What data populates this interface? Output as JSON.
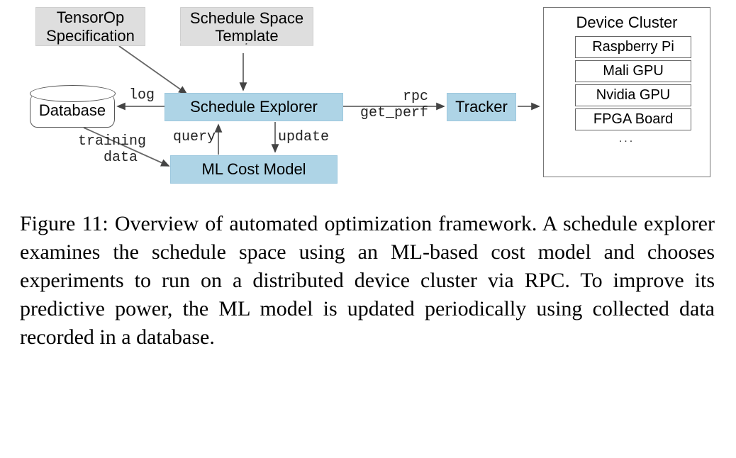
{
  "nodes": {
    "tensorop": "TensorOp\nSpecification",
    "schedSpace": "Schedule Space\nTemplate",
    "database": "Database",
    "schedExpl": "Schedule Explorer",
    "mlCost": "ML Cost Model",
    "tracker": "Tracker"
  },
  "labels": {
    "log": "log",
    "trainingData": "training\n  data",
    "query": "query",
    "update": "update",
    "rpc": "     rpc\nget_perf"
  },
  "cluster": {
    "title": "Device Cluster",
    "devices": [
      "Raspberry Pi",
      "Mali GPU",
      "Nvidia GPU",
      "FPGA Board"
    ],
    "ellipsis": "..."
  },
  "caption": "Figure 11: Overview of automated optimization framework. A schedule explorer examines the schedule space using an ML-based cost model and chooses experiments to run on a distributed device cluster via RPC. To improve its predictive power, the ML model is updated periodically using collected data recorded in a database."
}
